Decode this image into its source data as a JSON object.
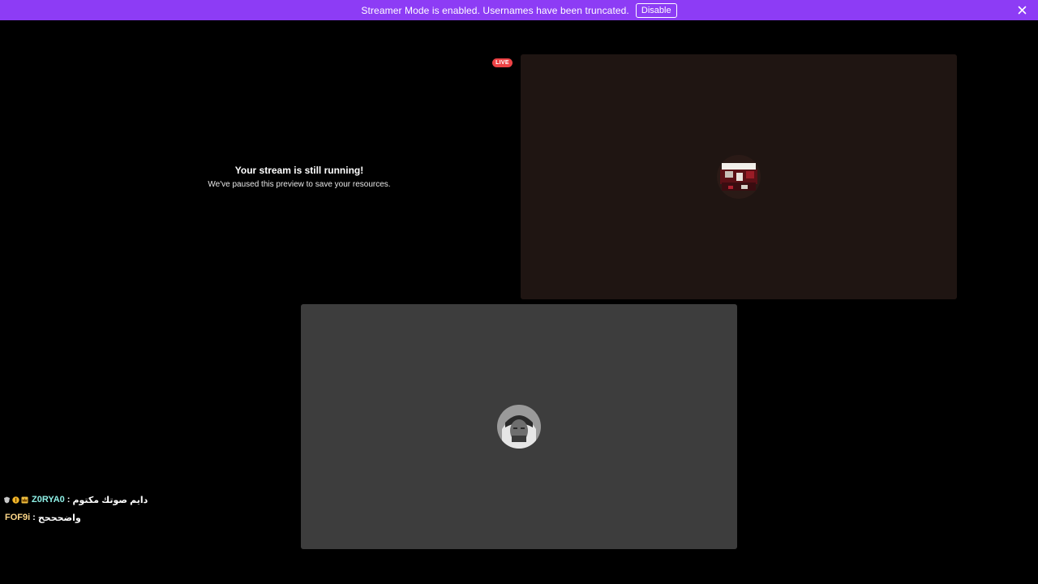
{
  "banner": {
    "text": "Streamer Mode is enabled. Usernames have been truncated.",
    "disable_label": "Disable",
    "color": "#8d3cf5"
  },
  "preview": {
    "title": "Your stream is still running!",
    "subtitle": "We've paused this preview to save your resources."
  },
  "live_badge": {
    "label": "LIVE",
    "color": "#ed4245"
  },
  "tiles": [
    {
      "name": "stream-preview",
      "background": "#1f1512"
    },
    {
      "name": "participant",
      "background": "#3d3d3d"
    }
  ],
  "chat": {
    "messages": [
      {
        "badges": [
          "mod-badge-icon",
          "coin-badge-icon",
          "crown-badge-icon"
        ],
        "user": "Z0RYA0",
        "separator": ":",
        "text": "دايم صوتك مكتوم"
      },
      {
        "badges": [],
        "user": "FOF9i",
        "separator": ":",
        "text": "واضحححح"
      }
    ]
  }
}
